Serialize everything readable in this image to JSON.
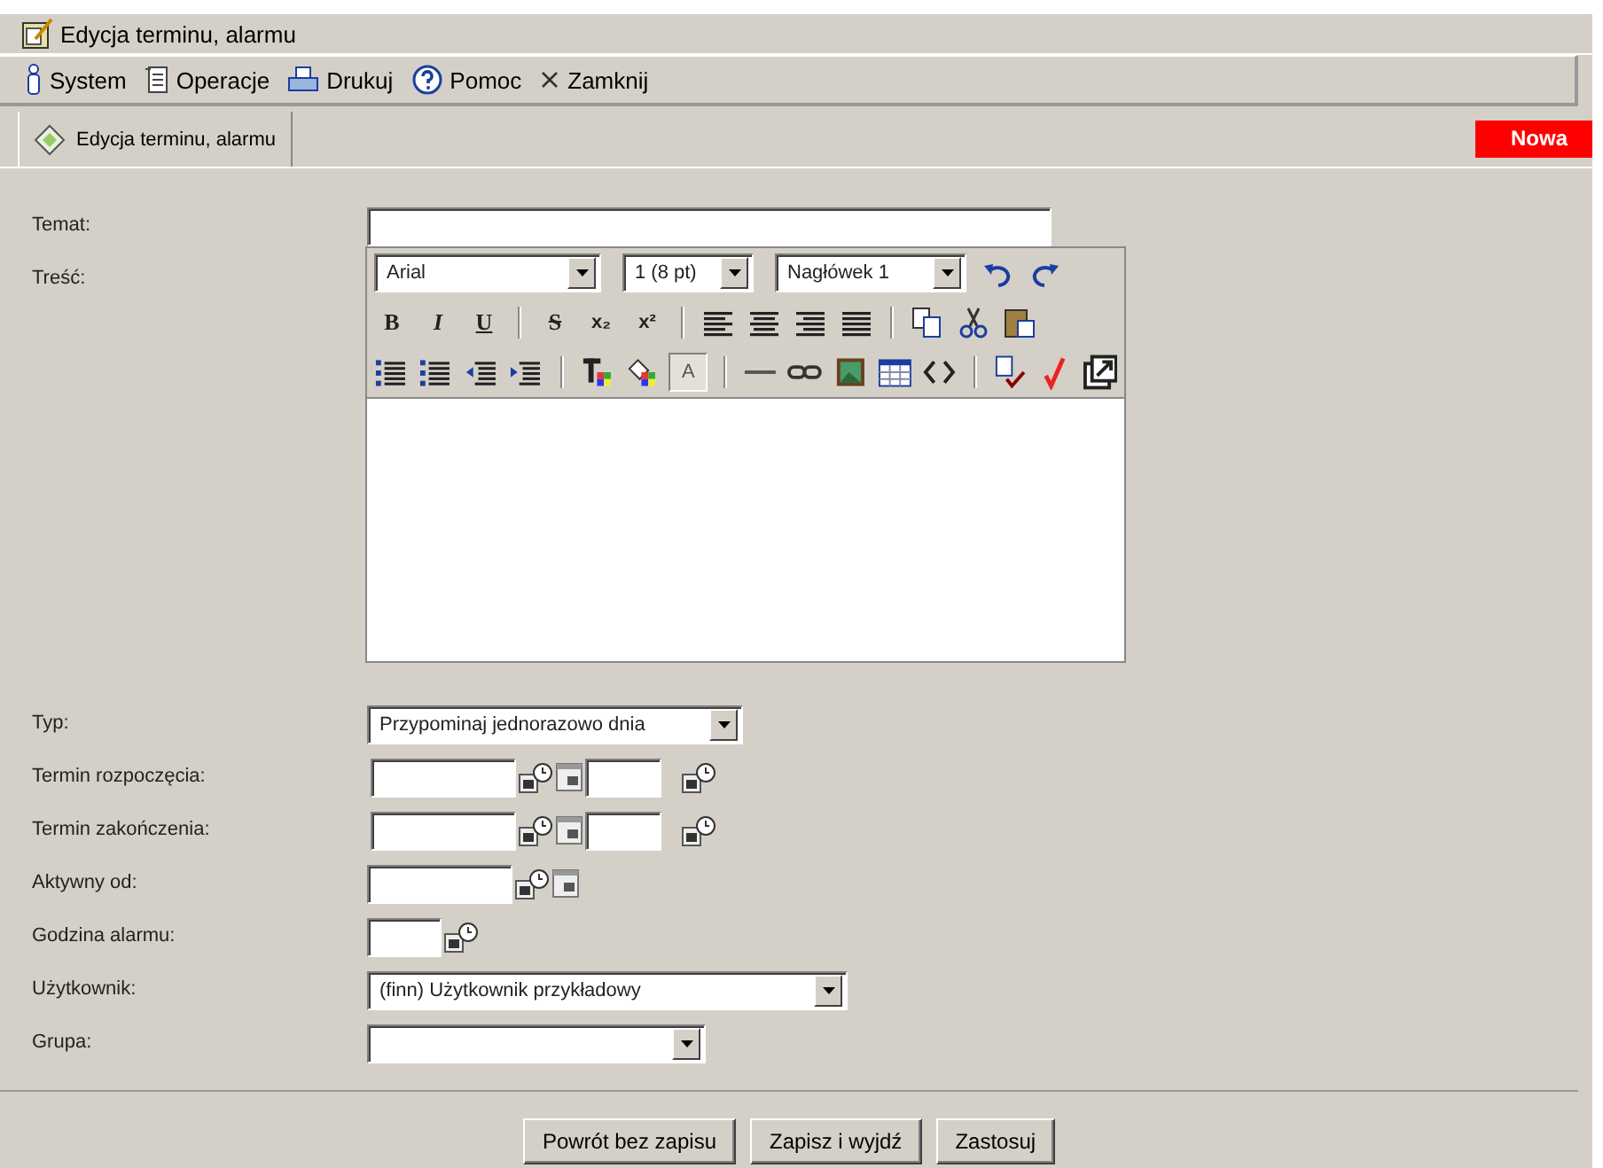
{
  "window": {
    "title": "Edycja terminu, alarmu"
  },
  "menu": [
    {
      "label": "System"
    },
    {
      "label": "Operacje"
    },
    {
      "label": "Drukuj"
    },
    {
      "label": "Pomoc"
    },
    {
      "label": "Zamknij"
    }
  ],
  "tabs": [
    {
      "label": "Edycja terminu, alarmu",
      "selected": true
    }
  ],
  "badge": "Nowa",
  "editor": {
    "font": "Arial",
    "size": "1 (8 pt)",
    "format": "Nagłówek 1",
    "glyphs": [
      "B",
      "I",
      "U",
      "S",
      "x₂",
      "x²",
      "A"
    ]
  },
  "fields": [
    {
      "label": "Temat:",
      "kind": "text"
    },
    {
      "label": "Treść:",
      "kind": "editor"
    },
    {
      "label": "Typ:",
      "kind": "select",
      "value": "Przypominaj jednorazowo dnia"
    },
    {
      "label": "Termin rozpoczęcia:",
      "kind": "datetime"
    },
    {
      "label": "Termin zakończenia:",
      "kind": "datetime"
    },
    {
      "label": "Aktywny od:",
      "kind": "date"
    },
    {
      "label": "Godzina alarmu:",
      "kind": "time"
    },
    {
      "label": "Użytkownik:",
      "kind": "select",
      "value": "(finn) Użytkownik przykładowy"
    },
    {
      "label": "Grupa:",
      "kind": "select"
    }
  ],
  "buttons": [
    {
      "label": "Powrót bez zapisu"
    },
    {
      "label": "Zapisz i wyjdź"
    },
    {
      "label": "Zastosuj"
    }
  ]
}
